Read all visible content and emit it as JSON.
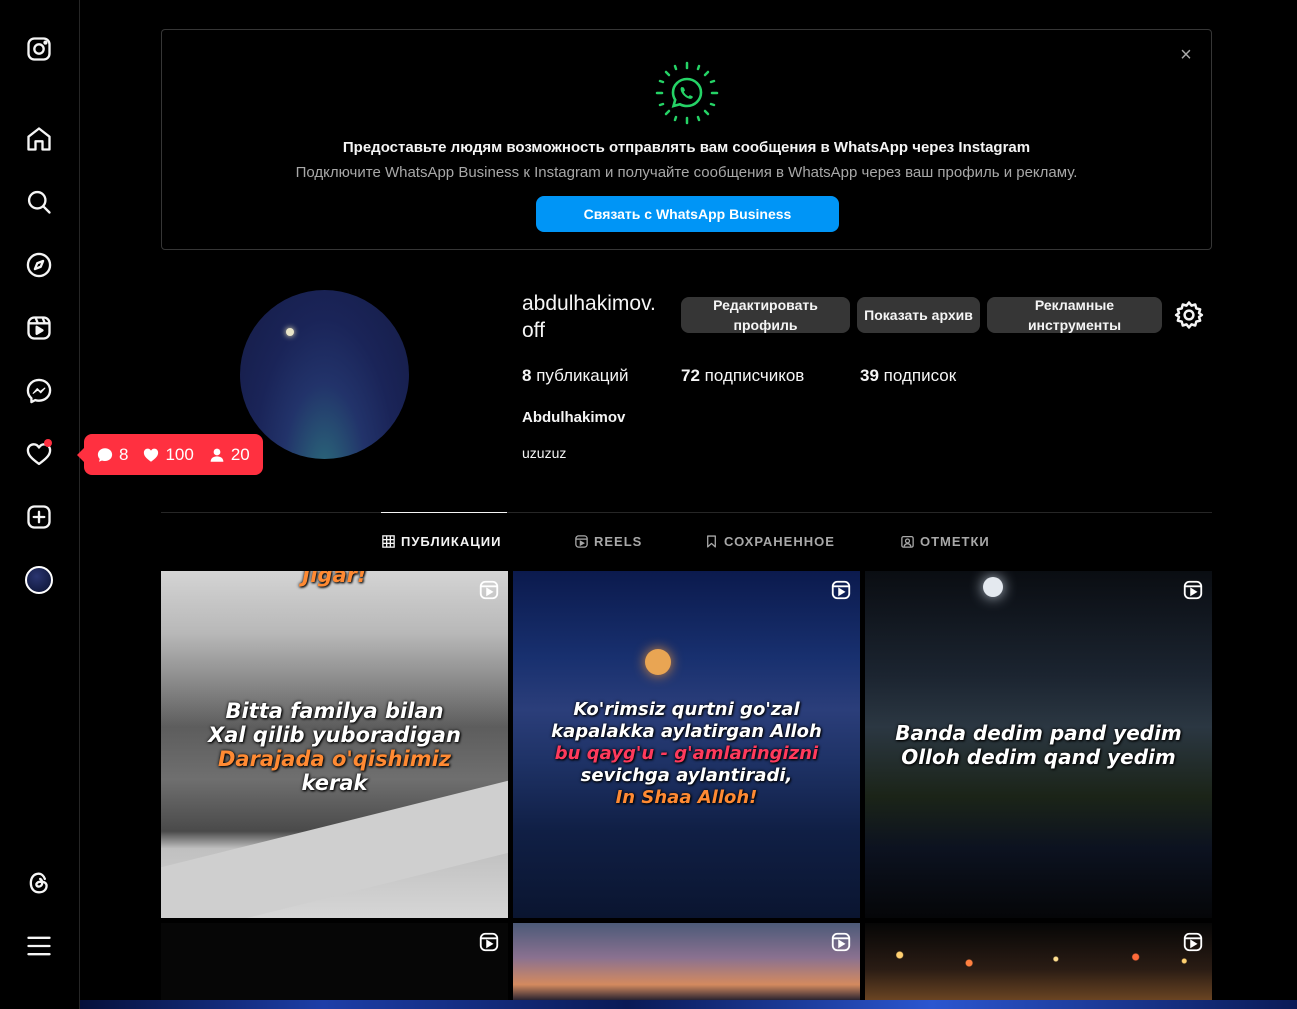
{
  "sidebar": {
    "items": [
      {
        "icon": "instagram-logo-icon"
      },
      {
        "icon": "home-icon"
      },
      {
        "icon": "search-icon"
      },
      {
        "icon": "explore-compass-icon"
      },
      {
        "icon": "reels-icon"
      },
      {
        "icon": "messenger-icon"
      },
      {
        "icon": "heart-notifications-icon"
      },
      {
        "icon": "create-plus-icon"
      },
      {
        "icon": "profile-avatar"
      },
      {
        "icon": "threads-icon"
      },
      {
        "icon": "menu-hamburger-icon"
      }
    ]
  },
  "activity": {
    "comments": "8",
    "likes": "100",
    "followers": "20"
  },
  "whatsapp_banner": {
    "title": "Предоставьте людям возможность отправлять вам сообщения в WhatsApp через Instagram",
    "subtitle": "Подключите WhatsApp Business к Instagram и получайте сообщения в WhatsApp через ваш профиль и рекламу.",
    "button": "Связать с WhatsApp Business",
    "close": "×",
    "accent": "#25d366"
  },
  "profile": {
    "username": "abdulhakimov.off",
    "buttons": {
      "edit": "Редактировать профиль",
      "archive": "Показать архив",
      "ads": "Рекламные инструменты"
    },
    "stats": {
      "posts_count": "8",
      "posts_label": "публикаций",
      "followers_count": "72",
      "followers_label": "подписчиков",
      "following_count": "39",
      "following_label": "подписок"
    },
    "full_name": "Abdulhakimov",
    "bio": "uzuzuz"
  },
  "tabs": [
    {
      "label": "ПУБЛИКАЦИИ",
      "icon": "grid-icon",
      "active": true
    },
    {
      "label": "REELS",
      "icon": "reels-icon",
      "active": false
    },
    {
      "label": "СОХРАНЕННОЕ",
      "icon": "bookmark-icon",
      "active": false
    },
    {
      "label": "ОТМЕТКИ",
      "icon": "tagged-icon",
      "active": false
    }
  ],
  "posts": [
    {
      "lines": [
        "Jigar!",
        "Bitta familya bilan",
        "Xal qilib yuboradigan",
        "Darajada o'qishimiz",
        "kerak"
      ]
    },
    {
      "lines": [
        "Ko'rimsiz qurtni go'zal",
        "kapalakka aylatirgan Alloh",
        "bu qayg'u - g'amlaringizni",
        "sevichga aylantiradi,",
        "In Shaa Alloh!"
      ]
    },
    {
      "lines": [
        "Banda dedim pand yedim",
        "Olloh dedim qand yedim"
      ]
    }
  ],
  "colors": {
    "primary_button": "#0095f6",
    "secondary_button": "#363636",
    "notification": "#ff3040"
  }
}
